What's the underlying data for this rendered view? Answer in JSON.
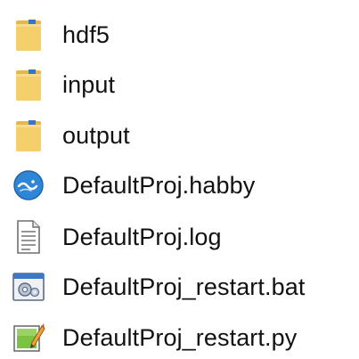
{
  "files": [
    {
      "name": "hdf5",
      "icon": "folder-icon",
      "type": "folder"
    },
    {
      "name": "input",
      "icon": "folder-icon",
      "type": "folder"
    },
    {
      "name": "output",
      "icon": "folder-icon",
      "type": "folder"
    },
    {
      "name": "DefaultProj.habby",
      "icon": "habby-file-icon",
      "type": "file"
    },
    {
      "name": "DefaultProj.log",
      "icon": "text-document-icon",
      "type": "file"
    },
    {
      "name": "DefaultProj_restart.bat",
      "icon": "batch-file-icon",
      "type": "file"
    },
    {
      "name": "DefaultProj_restart.py",
      "icon": "python-script-icon",
      "type": "file"
    }
  ],
  "colors": {
    "folder_body": "#f4cf6b",
    "folder_tab": "#e4b84a",
    "habby_blue": "#2f86d6",
    "pin_blue": "#3a74c8"
  }
}
